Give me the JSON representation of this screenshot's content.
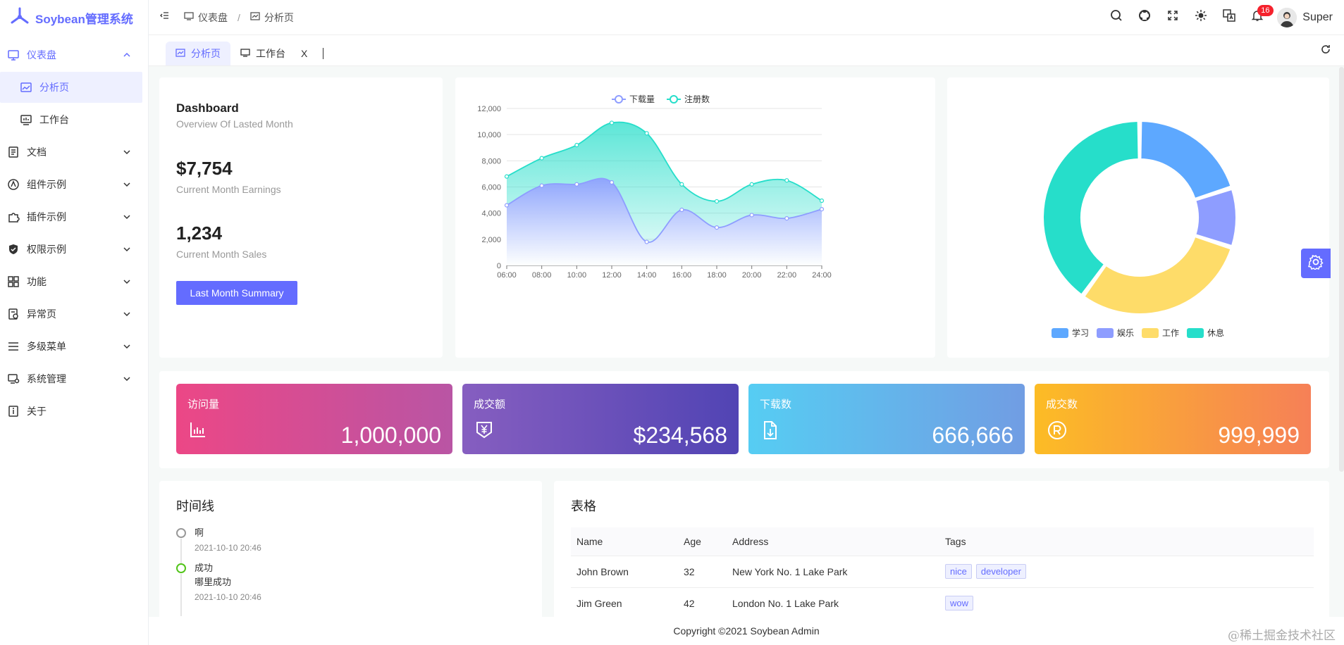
{
  "app": {
    "title": "Soybean管理系统"
  },
  "sidebar": {
    "items": [
      {
        "label": "仪表盘",
        "icon": "monitor-icon",
        "open": true,
        "children": [
          {
            "label": "分析页",
            "icon": "chart-panel-icon",
            "active": true
          },
          {
            "label": "工作台",
            "icon": "workbench-icon"
          }
        ]
      },
      {
        "label": "文档",
        "icon": "document-icon"
      },
      {
        "label": "组件示例",
        "icon": "component-icon"
      },
      {
        "label": "插件示例",
        "icon": "plugin-icon"
      },
      {
        "label": "权限示例",
        "icon": "shield-icon"
      },
      {
        "label": "功能",
        "icon": "grid-icon"
      },
      {
        "label": "异常页",
        "icon": "exception-icon"
      },
      {
        "label": "多级菜单",
        "icon": "list-icon"
      },
      {
        "label": "系统管理",
        "icon": "settings-monitor-icon"
      },
      {
        "label": "关于",
        "icon": "info-icon"
      }
    ]
  },
  "header": {
    "breadcrumb": [
      "仪表盘",
      "分析页"
    ],
    "notification_count": "16",
    "user_name": "Super"
  },
  "tabs": [
    {
      "label": "分析页",
      "active": true
    },
    {
      "label": "工作台",
      "closable": true,
      "close": "X"
    }
  ],
  "summary": {
    "title": "Dashboard",
    "subtitle": "Overview Of Lasted Month",
    "earnings_value": "$7,754",
    "earnings_label": "Current Month Earnings",
    "sales_value": "1,234",
    "sales_label": "Current Month Sales",
    "button": "Last Month Summary"
  },
  "chart_data": [
    {
      "type": "area",
      "x": [
        "06:00",
        "08:00",
        "10:00",
        "12:00",
        "14:00",
        "16:00",
        "18:00",
        "20:00",
        "22:00",
        "24:00"
      ],
      "series": [
        {
          "name": "下载量",
          "values": [
            4600,
            6100,
            6200,
            6350,
            1800,
            4250,
            2900,
            3850,
            3600,
            4300
          ],
          "color": "#8e9dff"
        },
        {
          "name": "注册数",
          "values": [
            6800,
            8200,
            9200,
            10900,
            10100,
            6200,
            4900,
            6200,
            6500,
            4950
          ],
          "color": "#26deca"
        }
      ],
      "yticks": [
        "0",
        "2,000",
        "4,000",
        "6,000",
        "8,000",
        "10,000",
        "12,000"
      ],
      "ylim": [
        0,
        12000
      ],
      "legend": "top-center",
      "grid": true
    },
    {
      "type": "pie",
      "series": [
        {
          "name": "学习",
          "value": 20,
          "color": "#5da8ff"
        },
        {
          "name": "娱乐",
          "value": 10,
          "color": "#8e9dff"
        },
        {
          "name": "工作",
          "value": 30,
          "color": "#fedc69"
        },
        {
          "name": "休息",
          "value": 40,
          "color": "#26deca"
        }
      ],
      "legend": "bottom-center",
      "donut": true
    }
  ],
  "stats": [
    {
      "title": "访问量",
      "value": "1,000,000",
      "icon": "bar-chart-icon",
      "from": "#ec4786",
      "to": "#b955a4"
    },
    {
      "title": "成交额",
      "value": "$234,568",
      "icon": "yen-tag-icon",
      "from": "#865ec0",
      "to": "#5144b4"
    },
    {
      "title": "下载数",
      "value": "666,666",
      "icon": "download-file-icon",
      "from": "#56cdf3",
      "to": "#719de3"
    },
    {
      "title": "成交数",
      "value": "999,999",
      "icon": "registered-icon",
      "from": "#fcbc25",
      "to": "#f68057"
    }
  ],
  "timeline": {
    "title": "时间线",
    "items": [
      {
        "title": "啊",
        "time": "2021-10-10 20:46",
        "color": "#999999"
      },
      {
        "title": "成功",
        "content": "哪里成功",
        "time": "2021-10-10 20:46",
        "color": "#52c41a"
      }
    ]
  },
  "table": {
    "title": "表格",
    "columns": [
      "Name",
      "Age",
      "Address",
      "Tags"
    ],
    "rows": [
      {
        "name": "John Brown",
        "age": "32",
        "address": "New York No. 1 Lake Park",
        "tags": [
          "nice",
          "developer"
        ]
      },
      {
        "name": "Jim Green",
        "age": "42",
        "address": "London No. 1 Lake Park",
        "tags": [
          "wow"
        ]
      }
    ]
  },
  "footer": {
    "text": "Copyright ©2021 Soybean Admin"
  },
  "watermark": "@稀土掘金技术社区"
}
